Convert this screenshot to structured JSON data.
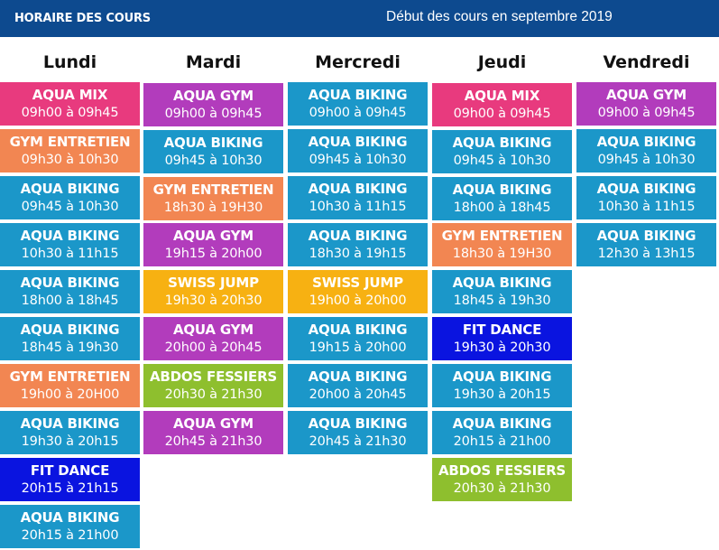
{
  "header": {
    "left": "HORAIRE DES COURS",
    "right": "Début des cours en septembre 2019"
  },
  "colors": {
    "header_bg": "#0d4a8f",
    "aqua_biking": "#1b97c9",
    "aqua_mix": "#e83a7e",
    "aqua_gym": "#b23cbc",
    "gym_entretien": "#f28652",
    "swiss_jump": "#f7b112",
    "fit_dance": "#0a14e0",
    "abdos_fessiers": "#8ebf2e"
  },
  "days": [
    {
      "name": "Lundi",
      "classes": [
        {
          "name": "AQUA MIX",
          "time": "09h00 à 09h45",
          "color": "#e83a7e"
        },
        {
          "name": "GYM ENTRETIEN",
          "time": "09h30 à 10h30",
          "color": "#f28652"
        },
        {
          "name": "AQUA BIKING",
          "time": "09h45 à 10h30",
          "color": "#1b97c9"
        },
        {
          "name": "AQUA BIKING",
          "time": "10h30 à 11h15",
          "color": "#1b97c9"
        },
        {
          "name": "AQUA BIKING",
          "time": "18h00 à 18h45",
          "color": "#1b97c9"
        },
        {
          "name": "AQUA BIKING",
          "time": "18h45 à 19h30",
          "color": "#1b97c9"
        },
        {
          "name": "GYM ENTRETIEN",
          "time": "19h00 à 20H00",
          "color": "#f28652"
        },
        {
          "name": "AQUA BIKING",
          "time": "19h30 à 20h15",
          "color": "#1b97c9"
        },
        {
          "name": "FIT DANCE",
          "time": "20h15 à 21h15",
          "color": "#0a14e0"
        },
        {
          "name": "AQUA BIKING",
          "time": "20h15 à 21h00",
          "color": "#1b97c9"
        }
      ]
    },
    {
      "name": "Mardi",
      "classes": [
        {
          "name": "AQUA GYM",
          "time": "09h00 à 09h45",
          "color": "#b23cbc"
        },
        {
          "name": "AQUA BIKING",
          "time": "09h45 à 10h30",
          "color": "#1b97c9"
        },
        {
          "name": "GYM ENTRETIEN",
          "time": "18h30 à 19H30",
          "color": "#f28652"
        },
        {
          "name": "AQUA GYM",
          "time": "19h15 à 20h00",
          "color": "#b23cbc"
        },
        {
          "name": "SWISS JUMP",
          "time": "19h30 à 20h30",
          "color": "#f7b112"
        },
        {
          "name": "AQUA GYM",
          "time": "20h00 à 20h45",
          "color": "#b23cbc"
        },
        {
          "name": "ABDOS FESSIERS",
          "time": "20h30 à 21h30",
          "color": "#8ebf2e"
        },
        {
          "name": "AQUA GYM",
          "time": "20h45 à 21h30",
          "color": "#b23cbc"
        }
      ]
    },
    {
      "name": "Mercredi",
      "classes": [
        {
          "name": "AQUA BIKING",
          "time": "09h00 à 09h45",
          "color": "#1b97c9"
        },
        {
          "name": "AQUA BIKING",
          "time": "09h45 à 10h30",
          "color": "#1b97c9"
        },
        {
          "name": "AQUA BIKING",
          "time": "10h30 à 11h15",
          "color": "#1b97c9"
        },
        {
          "name": "AQUA BIKING",
          "time": "18h30 à 19h15",
          "color": "#1b97c9"
        },
        {
          "name": "SWISS JUMP",
          "time": "19h00 à 20h00",
          "color": "#f7b112"
        },
        {
          "name": "AQUA BIKING",
          "time": "19h15 à 20h00",
          "color": "#1b97c9"
        },
        {
          "name": "AQUA BIKING",
          "time": "20h00 à 20h45",
          "color": "#1b97c9"
        },
        {
          "name": "AQUA BIKING",
          "time": "20h45 à 21h30",
          "color": "#1b97c9"
        }
      ]
    },
    {
      "name": "Jeudi",
      "classes": [
        {
          "name": "AQUA MIX",
          "time": "09h00 à 09h45",
          "color": "#e83a7e"
        },
        {
          "name": "AQUA BIKING",
          "time": "09h45 à 10h30",
          "color": "#1b97c9"
        },
        {
          "name": "AQUA BIKING",
          "time": "18h00 à 18h45",
          "color": "#1b97c9"
        },
        {
          "name": "GYM ENTRETIEN",
          "time": "18h30 à 19H30",
          "color": "#f28652"
        },
        {
          "name": "AQUA BIKING",
          "time": "18h45 à 19h30",
          "color": "#1b97c9"
        },
        {
          "name": "FIT DANCE",
          "time": "19h30 à 20h30",
          "color": "#0a14e0"
        },
        {
          "name": "AQUA BIKING",
          "time": "19h30 à 20h15",
          "color": "#1b97c9"
        },
        {
          "name": "AQUA BIKING",
          "time": "20h15 à 21h00",
          "color": "#1b97c9"
        },
        {
          "name": "ABDOS FESSIERS",
          "time": "20h30 à 21h30",
          "color": "#8ebf2e"
        }
      ]
    },
    {
      "name": "Vendredi",
      "classes": [
        {
          "name": "AQUA GYM",
          "time": "09h00 à 09h45",
          "color": "#b23cbc"
        },
        {
          "name": "AQUA BIKING",
          "time": "09h45 à 10h30",
          "color": "#1b97c9"
        },
        {
          "name": "AQUA BIKING",
          "time": "10h30 à 11h15",
          "color": "#1b97c9"
        },
        {
          "name": "AQUA BIKING",
          "time": "12h30 à 13h15",
          "color": "#1b97c9"
        }
      ]
    }
  ]
}
